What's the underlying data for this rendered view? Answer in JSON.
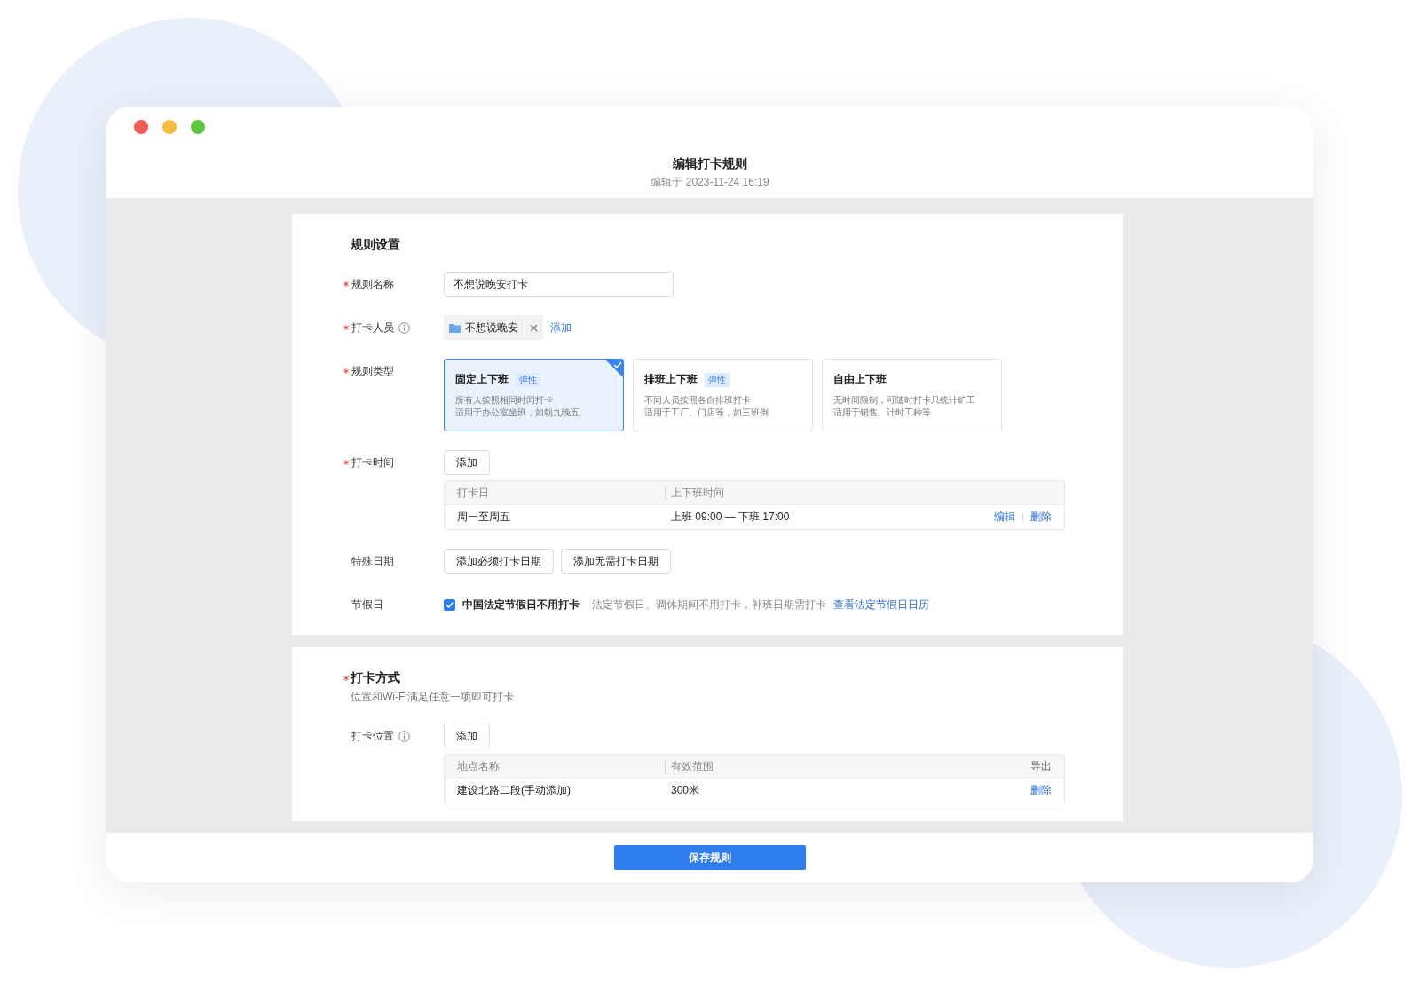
{
  "window": {
    "title": "编辑打卡规则",
    "subtitle": "编辑于 2023-11-24 16:19"
  },
  "rule_settings": {
    "title": "规则设置",
    "rows": [
      {
        "kind": "input",
        "label": "规则名称",
        "required": true,
        "value": "不想说晚安打卡"
      },
      {
        "kind": "members",
        "label": "打卡人员",
        "required": true,
        "info": true,
        "tags": [
          "不想说晚安"
        ],
        "add": "添加"
      },
      {
        "kind": "types",
        "label": "规则类型",
        "required": true,
        "options": [
          {
            "title": "固定上下班",
            "badge": "弹性",
            "lines": [
              "所有人按照相同时间打卡",
              "适用于办公室坐班，如朝九晚五"
            ],
            "selected": true
          },
          {
            "title": "排班上下班",
            "badge": "弹性",
            "lines": [
              "不同人员按照各自排班打卡",
              "适用于工厂、门店等，如三班倒"
            ],
            "selected": false
          },
          {
            "title": "自由上下班",
            "lines": [
              "无时间限制，可随时打卡只统计旷工",
              "适用于销售、计时工种等"
            ],
            "selected": false
          }
        ]
      },
      {
        "kind": "table",
        "label": "打卡时间",
        "required": true,
        "button": "添加",
        "columns": [
          "打卡日",
          "上下班时间"
        ],
        "rows": [
          {
            "cells": [
              "周一至周五",
              "上班 09:00 — 下班 17:00"
            ],
            "actions": [
              "编辑",
              "删除"
            ]
          }
        ]
      },
      {
        "kind": "buttons",
        "label": "特殊日期",
        "required": false,
        "buttons": [
          "添加必须打卡日期",
          "添加无需打卡日期"
        ]
      },
      {
        "kind": "checkbox",
        "label": "节假日",
        "required": false,
        "checked": true,
        "text": "中国法定节假日不用打卡",
        "hint": "法定节假日、调休期间不用打卡，补班日期需打卡",
        "link": "查看法定节假日日历"
      }
    ]
  },
  "check_in_method": {
    "title": "打卡方式",
    "required": true,
    "subtitle": "位置和Wi-Fi满足任意一项即可打卡",
    "rows": [
      {
        "kind": "table",
        "label": "打卡位置",
        "required": false,
        "info": true,
        "button": "添加",
        "columns": [
          "地点名称",
          "有效范围"
        ],
        "header_action": "导出",
        "rows": [
          {
            "cells": [
              "建设北路二段(手动添加)",
              "300米"
            ],
            "actions": [
              "删除"
            ]
          }
        ]
      }
    ]
  },
  "save_button": "保存规则"
}
